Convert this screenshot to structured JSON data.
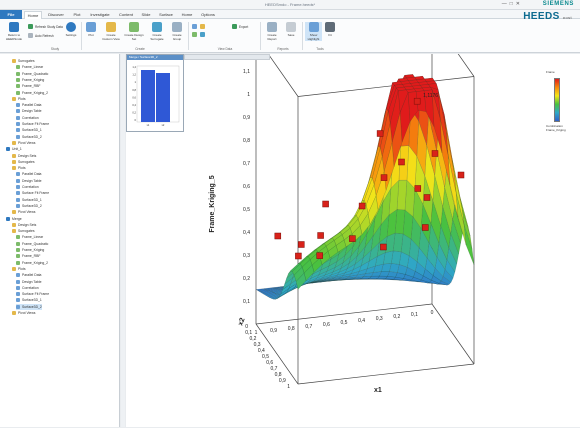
{
  "window": {
    "title": "HEEDSmdo - Frame.heeds*",
    "brand": "SIEMENS",
    "buttons": [
      "—",
      "□",
      "✕"
    ]
  },
  "ribbon": {
    "tabs": [
      "File",
      "Home",
      "Discover",
      "Plot",
      "Investigate",
      "Content",
      "Slide",
      "Surface",
      "Home",
      "Options"
    ],
    "product": "HEEDS",
    "product_sub": "post",
    "buttons": {
      "return": "Return to HEEDSmdo",
      "refresh": "Refresh Study Data",
      "archive": "Auto Refresh",
      "settings": "Settings",
      "plot": "Plot",
      "create_custom": "Create Custom View",
      "create_table": "Create Design Set",
      "create_surrogate": "Create Surrogate",
      "create_group": "Create Group",
      "report": "Create Report",
      "export": "Export",
      "show_highlight": "Show Highlight",
      "fit": "Fit",
      "save": "Save",
      "help": "Help"
    },
    "groups": [
      "Study",
      "Create",
      "View Data",
      "Reports",
      "Tools"
    ]
  },
  "tree": {
    "items": [
      "Surrogates",
      "Frame_Linear",
      "Frame_Quadratic",
      "Frame_Kriging",
      "Frame_RBF",
      "Frame_Kriging_2",
      "Plots",
      "Parallel Data",
      "Design Table",
      "Correlation",
      "Surface Fit Frame",
      "Surface3D_1",
      "Surface3D_2",
      "Pivot Views",
      "Unit_1",
      "Design Sets",
      "Surrogates",
      "Plots",
      "Parallel Data",
      "Design Table",
      "Correlation",
      "Surface Fit Frame",
      "Surface3D_1",
      "Surface3D_2",
      "Pivot Views",
      "Merge",
      "Design Sets",
      "Surrogates",
      "Frame_Linear",
      "Frame_Quadratic",
      "Frame_Kriging",
      "Frame_RBF",
      "Frame_Kriging_2",
      "Plots",
      "Parallel Data",
      "Design Table",
      "Correlation",
      "Surface Fit Frame",
      "Surface3D_1",
      "Surface3D_2",
      "Pivot Views"
    ]
  },
  "subwindow": {
    "title": "Merge / Surface3D_2",
    "ylabel": "",
    "xticks": [
      "x1",
      "x2"
    ],
    "yticks": [
      "1,4",
      "1,2",
      "1",
      "0,8",
      "0,6",
      "0,4",
      "0,2",
      "0"
    ]
  },
  "legend": {
    "title": "Frame",
    "mid": "Combination",
    "sub": "Frame_Kriging"
  },
  "plot3d": {
    "zlabel": "Frame_Kriging_5",
    "xlabel": "x1",
    "ylabel": "x2",
    "peak_label": "1,1176",
    "zticks": [
      "1,2",
      "1,1",
      "1",
      "0,9",
      "0,8",
      "0,7",
      "0,6",
      "0,5",
      "0,4",
      "0,3",
      "0,2",
      "0,1"
    ],
    "x1ticks": [
      "1",
      "0,9",
      "0,8",
      "0,7",
      "0,6",
      "0,5",
      "0,4",
      "0,3",
      "0,2",
      "0,1",
      "0"
    ],
    "x2ticks": [
      "0",
      "0,1",
      "0,2",
      "0,3",
      "0,4",
      "0,5",
      "0,6",
      "0,7",
      "0,8",
      "0,9",
      "1"
    ]
  },
  "colors": {
    "accent": "#2f79c0",
    "selection": "#cfe4f7"
  }
}
